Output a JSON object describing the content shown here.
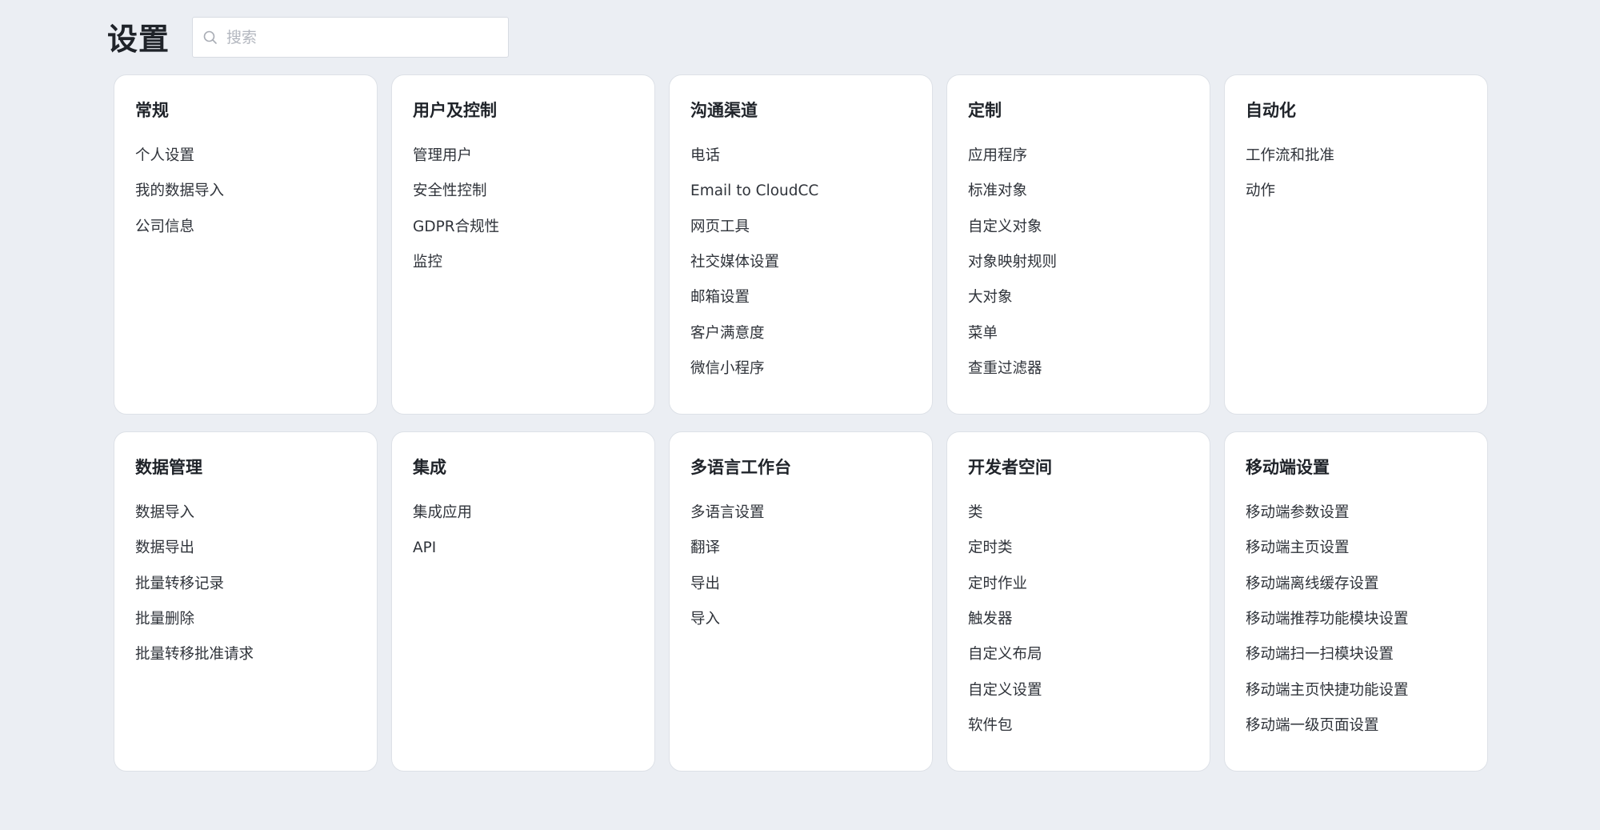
{
  "page": {
    "title": "设置"
  },
  "search": {
    "placeholder": "搜索",
    "value": ""
  },
  "sections": [
    {
      "title": "常规",
      "items": [
        "个人设置",
        "我的数据导入",
        "公司信息"
      ]
    },
    {
      "title": "用户及控制",
      "items": [
        "管理用户",
        "安全性控制",
        "GDPR合规性",
        "监控"
      ]
    },
    {
      "title": "沟通渠道",
      "items": [
        "电话",
        "Email to CloudCC",
        "网页工具",
        "社交媒体设置",
        "邮箱设置",
        "客户满意度",
        "微信小程序"
      ]
    },
    {
      "title": "定制",
      "items": [
        "应用程序",
        "标准对象",
        "自定义对象",
        "对象映射规则",
        "大对象",
        "菜单",
        "查重过滤器"
      ]
    },
    {
      "title": "自动化",
      "items": [
        "工作流和批准",
        "动作"
      ]
    },
    {
      "title": "数据管理",
      "items": [
        "数据导入",
        "数据导出",
        "批量转移记录",
        "批量删除",
        "批量转移批准请求"
      ]
    },
    {
      "title": "集成",
      "items": [
        "集成应用",
        "API"
      ]
    },
    {
      "title": "多语言工作台",
      "items": [
        "多语言设置",
        "翻译",
        "导出",
        "导入"
      ]
    },
    {
      "title": "开发者空间",
      "items": [
        "类",
        "定时类",
        "定时作业",
        "触发器",
        "自定义布局",
        "自定义设置",
        "软件包"
      ]
    },
    {
      "title": "移动端设置",
      "items": [
        "移动端参数设置",
        "移动端主页设置",
        "移动端离线缓存设置",
        "移动端推荐功能模块设置",
        "移动端扫一扫模块设置",
        "移动端主页快捷功能设置",
        "移动端一级页面设置"
      ]
    }
  ]
}
